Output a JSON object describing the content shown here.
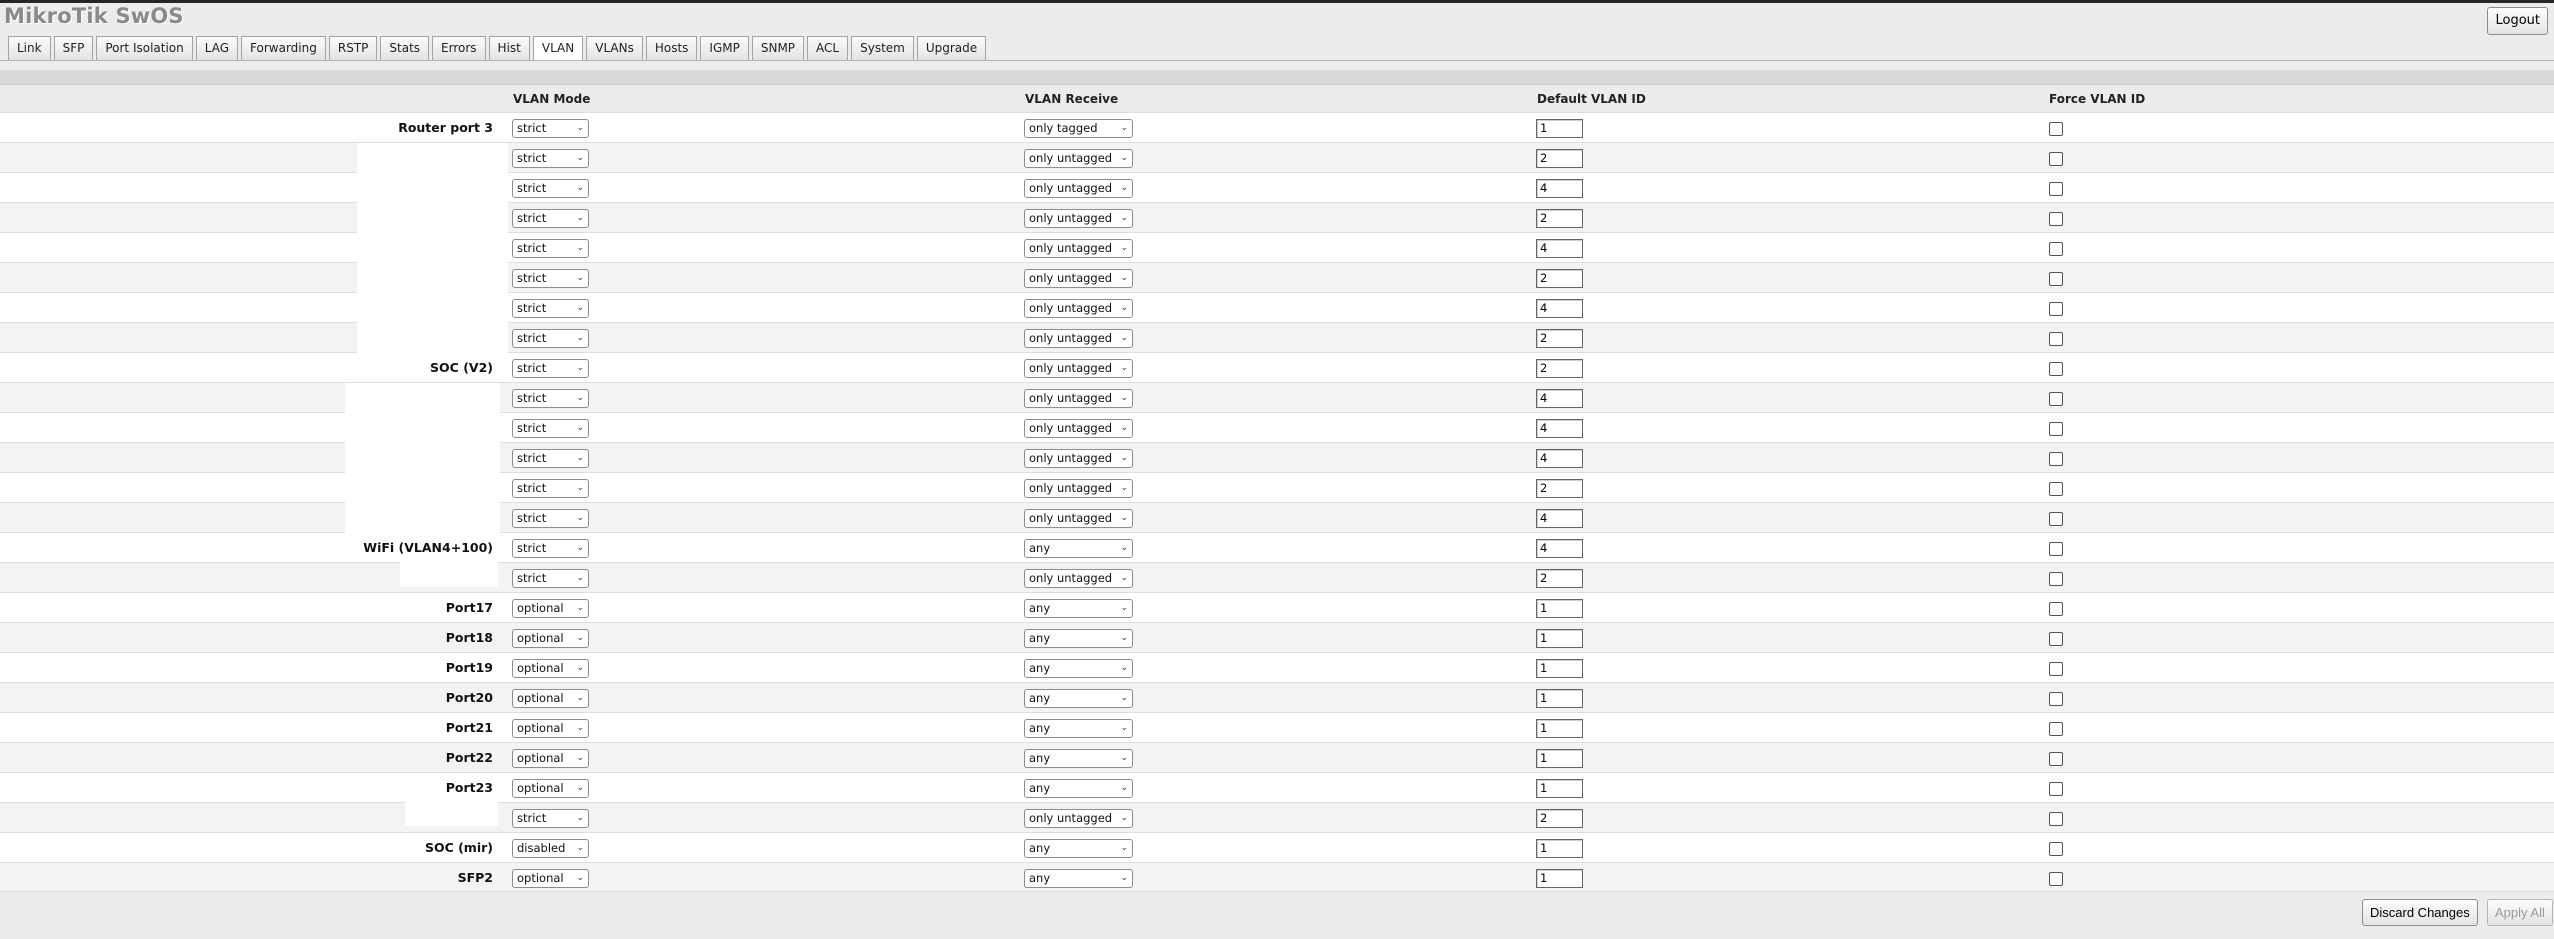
{
  "app": {
    "logo": "MikroTik SwOS",
    "logout_label": "Logout"
  },
  "tabs": [
    {
      "label": "Link"
    },
    {
      "label": "SFP"
    },
    {
      "label": "Port Isolation"
    },
    {
      "label": "LAG"
    },
    {
      "label": "Forwarding"
    },
    {
      "label": "RSTP"
    },
    {
      "label": "Stats"
    },
    {
      "label": "Errors"
    },
    {
      "label": "Hist"
    },
    {
      "label": "VLAN",
      "active": true
    },
    {
      "label": "VLANs"
    },
    {
      "label": "Hosts"
    },
    {
      "label": "IGMP"
    },
    {
      "label": "SNMP"
    },
    {
      "label": "ACL"
    },
    {
      "label": "System"
    },
    {
      "label": "Upgrade"
    }
  ],
  "columns": {
    "mode": "VLAN Mode",
    "receive": "VLAN Receive",
    "default_vlan": "Default VLAN ID",
    "force": "Force VLAN ID"
  },
  "rows": [
    {
      "name": "Router port 3",
      "mode": "strict",
      "receive": "only tagged",
      "vid": "1",
      "force": false
    },
    {
      "name": "",
      "mode": "strict",
      "receive": "only untagged",
      "vid": "2",
      "force": false
    },
    {
      "name": "",
      "mode": "strict",
      "receive": "only untagged",
      "vid": "4",
      "force": false
    },
    {
      "name": "",
      "mode": "strict",
      "receive": "only untagged",
      "vid": "2",
      "force": false
    },
    {
      "name": "",
      "mode": "strict",
      "receive": "only untagged",
      "vid": "4",
      "force": false
    },
    {
      "name": "",
      "mode": "strict",
      "receive": "only untagged",
      "vid": "2",
      "force": false
    },
    {
      "name": "",
      "mode": "strict",
      "receive": "only untagged",
      "vid": "4",
      "force": false
    },
    {
      "name": "",
      "mode": "strict",
      "receive": "only untagged",
      "vid": "2",
      "force": false
    },
    {
      "name": "SOC (V2)",
      "mode": "strict",
      "receive": "only untagged",
      "vid": "2",
      "force": false
    },
    {
      "name": "",
      "mode": "strict",
      "receive": "only untagged",
      "vid": "4",
      "force": false
    },
    {
      "name": "",
      "mode": "strict",
      "receive": "only untagged",
      "vid": "4",
      "force": false
    },
    {
      "name": "",
      "mode": "strict",
      "receive": "only untagged",
      "vid": "4",
      "force": false
    },
    {
      "name": "",
      "mode": "strict",
      "receive": "only untagged",
      "vid": "2",
      "force": false
    },
    {
      "name": "",
      "mode": "strict",
      "receive": "only untagged",
      "vid": "4",
      "force": false
    },
    {
      "name": "WiFi (VLAN4+100)",
      "mode": "strict",
      "receive": "any",
      "vid": "4",
      "force": false
    },
    {
      "name": "",
      "mode": "strict",
      "receive": "only untagged",
      "vid": "2",
      "force": false
    },
    {
      "name": "Port17",
      "mode": "optional",
      "receive": "any",
      "vid": "1",
      "force": false
    },
    {
      "name": "Port18",
      "mode": "optional",
      "receive": "any",
      "vid": "1",
      "force": false
    },
    {
      "name": "Port19",
      "mode": "optional",
      "receive": "any",
      "vid": "1",
      "force": false
    },
    {
      "name": "Port20",
      "mode": "optional",
      "receive": "any",
      "vid": "1",
      "force": false
    },
    {
      "name": "Port21",
      "mode": "optional",
      "receive": "any",
      "vid": "1",
      "force": false
    },
    {
      "name": "Port22",
      "mode": "optional",
      "receive": "any",
      "vid": "1",
      "force": false
    },
    {
      "name": "Port23",
      "mode": "optional",
      "receive": "any",
      "vid": "1",
      "force": false
    },
    {
      "name": "",
      "mode": "strict",
      "receive": "only untagged",
      "vid": "2",
      "force": false
    },
    {
      "name": "SOC (mir)",
      "mode": "disabled",
      "receive": "any",
      "vid": "1",
      "force": false
    },
    {
      "name": "SFP2",
      "mode": "optional",
      "receive": "any",
      "vid": "1",
      "force": false
    }
  ],
  "footer": {
    "discard_label": "Discard Changes",
    "apply_label": "Apply All"
  }
}
